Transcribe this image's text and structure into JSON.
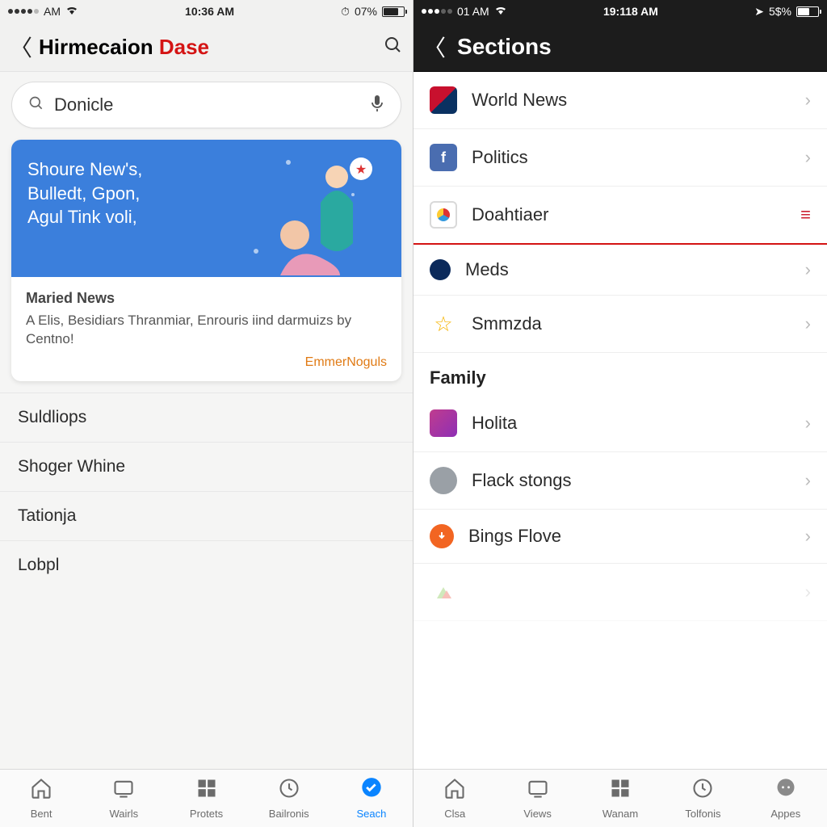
{
  "left": {
    "status": {
      "carrier": "AM",
      "time": "10:36 AM",
      "battery_pct": "07%"
    },
    "nav": {
      "title_a": "Hirmecaion ",
      "title_b": "Dase"
    },
    "search": {
      "value": "Donicle"
    },
    "hero": {
      "headline": "Shoure New's,\nBulledt, Gpon,\nAgul Tink voli,"
    },
    "card": {
      "section_title": "Maried News",
      "blurb": "A Elis, Besidiars Thranmiar, Enrouris iind darmuizs by Centno!",
      "link": "EmmerNoguls"
    },
    "list": [
      "Suldliops",
      "Shoger Whine",
      "Tationja",
      "Lobpl"
    ],
    "tabs": [
      {
        "label": "Bent",
        "icon": "home"
      },
      {
        "label": "Wairls",
        "icon": "tv"
      },
      {
        "label": "Protets",
        "icon": "grid"
      },
      {
        "label": "Bailronis",
        "icon": "clock"
      },
      {
        "label": "Seach",
        "icon": "check",
        "active": true
      }
    ]
  },
  "right": {
    "status": {
      "carrier": "01 AM",
      "time": "19:118 AM",
      "battery_pct": "5$%"
    },
    "nav": {
      "title": "Sections"
    },
    "sections_top": [
      {
        "label": "World News",
        "icon": "flag"
      },
      {
        "label": "Politics",
        "icon": "fb"
      },
      {
        "label": "Doahtiaer",
        "icon": "ring",
        "selected": true
      },
      {
        "label": "Meds",
        "icon": "navy"
      },
      {
        "label": "Smmzda",
        "icon": "star"
      }
    ],
    "group_header": "Family",
    "sections_family": [
      {
        "label": "Holita",
        "icon": "pink"
      },
      {
        "label": "Flack stongs",
        "icon": "grey"
      },
      {
        "label": "Bings Flove",
        "icon": "orange"
      },
      {
        "label": "",
        "icon": "tri",
        "faded": true
      }
    ],
    "tabs": [
      {
        "label": "Clsa",
        "icon": "home"
      },
      {
        "label": "Views",
        "icon": "tv"
      },
      {
        "label": "Wanam",
        "icon": "grid"
      },
      {
        "label": "Tolfonis",
        "icon": "clock"
      },
      {
        "label": "Appes",
        "icon": "bubble"
      }
    ]
  }
}
